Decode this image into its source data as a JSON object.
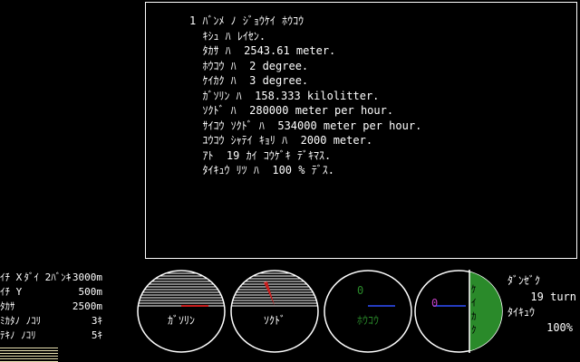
{
  "message": {
    "lines": [
      "1 ﾊﾞﾝﾒ ﾉ ｼﾞｮｳｹｲ ﾎｳｺｳ",
      "  ｷｼｭ ﾊ ﾚｲｾﾝ.",
      "  ﾀｶｻ ﾊ  2543.61 meter.",
      "  ﾎｳｺｳ ﾊ  2 degree.",
      "  ｹｲｶｸ ﾊ  3 degree.",
      "  ｶﾞｿﾘﾝ ﾊ  158.333 kilolitter.",
      "  ｿｸﾄﾞ ﾊ  280000 meter per hour.",
      "  ｻｲｺｳ ｿｸﾄﾞ ﾊ  534000 meter per hour.",
      "  ﾕｳｺｳ ｼｬﾃｲ ｷｮﾘ ﾊ  2000 meter.",
      "  ｱﾄ  19 ｶｲ ｺｳｹﾞｷ ﾃﾞｷﾏｽ.",
      "  ﾀｲｷｭｳ ﾘﾂ ﾊ  100 % ﾃﾞｽ."
    ]
  },
  "status": {
    "header": "ﾀﾞｲ 2ﾊﾞﾝｷ",
    "rows": [
      {
        "label": "ｲﾁ X",
        "value": "-3000m"
      },
      {
        "label": "ｲﾁ Y",
        "value": "500m"
      },
      {
        "label": "ﾀｶｻ",
        "value": "2500m"
      },
      {
        "label": "ﾐｶﾀﾉ ﾉｺﾘ",
        "value": "3ｷ"
      },
      {
        "label": "ﾃｷﾉ ﾉｺﾘ",
        "value": "5ｷ"
      }
    ]
  },
  "gauges": {
    "fuel_label": "ｶﾞｿﾘﾝ",
    "speed_label": "ｿｸﾄﾞ",
    "heading_label": "ﾎｳｺｳ",
    "heading_value": "0",
    "pitch_value": "0",
    "attitude_text": "ｹｲｶｸ"
  },
  "right_status": {
    "turn_label": "ﾀﾞﾝｾﾞｸ",
    "turn_value": "19 turn",
    "hp_label": "ﾀｲｷｭｳ",
    "hp_value": "100%"
  },
  "colors": {
    "green": "#2a8a2a",
    "red": "#c81e1e",
    "blue": "#3050ff",
    "magenta": "#c040c0",
    "cream": "#e8e0b0"
  }
}
